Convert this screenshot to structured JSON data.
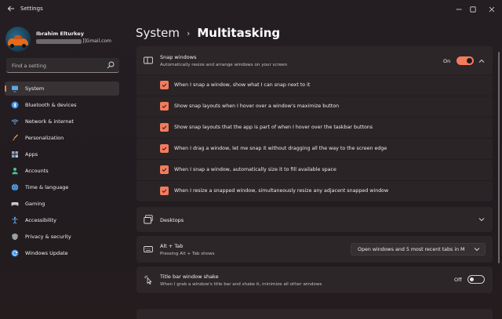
{
  "window": {
    "title": "Settings"
  },
  "user": {
    "name": "Ibrahim Elturkey",
    "email_suffix": "]]Gmail.com"
  },
  "search": {
    "placeholder": "Find a setting"
  },
  "sidebar": {
    "items": [
      {
        "label": "System",
        "icon": "monitor-icon",
        "color": "#5aa6e8",
        "active": true
      },
      {
        "label": "Bluetooth & devices",
        "icon": "bluetooth-icon",
        "color": "#3b8de0"
      },
      {
        "label": "Network & internet",
        "icon": "wifi-icon",
        "color": "#6ab0e8"
      },
      {
        "label": "Personalization",
        "icon": "brush-icon",
        "color": "#e09a5a"
      },
      {
        "label": "Apps",
        "icon": "apps-icon",
        "color": "#8fa6c8"
      },
      {
        "label": "Accounts",
        "icon": "person-icon",
        "color": "#4fc08f"
      },
      {
        "label": "Time & language",
        "icon": "globe-clock-icon",
        "color": "#5aa6e8"
      },
      {
        "label": "Gaming",
        "icon": "gamepad-icon",
        "color": "#c9c9c9"
      },
      {
        "label": "Accessibility",
        "icon": "accessibility-icon",
        "color": "#5aa6e8"
      },
      {
        "label": "Privacy & security",
        "icon": "shield-icon",
        "color": "#9aa0a6"
      },
      {
        "label": "Windows Update",
        "icon": "update-icon",
        "color": "#3b8de0"
      }
    ]
  },
  "breadcrumb": {
    "parent": "System",
    "separator": "›",
    "current": "Multitasking"
  },
  "snap": {
    "title": "Snap windows",
    "subtitle": "Automatically resize and arrange windows on your screen",
    "toggle_label": "On",
    "toggle_on": true,
    "options": [
      {
        "label": "When I snap a window, show what I can snap next to it",
        "checked": true
      },
      {
        "label": "Show snap layouts when I hover over a window's maximize button",
        "checked": true
      },
      {
        "label": "Show snap layouts that the app is part of when I hover over the taskbar buttons",
        "checked": true
      },
      {
        "label": "When I drag a window, let me snap it without dragging all the way to the screen edge",
        "checked": true
      },
      {
        "label": "When I snap a window, automatically size it to fill available space",
        "checked": true
      },
      {
        "label": "When I resize a snapped window, simultaneously resize any adjacent snapped window",
        "checked": true
      }
    ]
  },
  "desktops": {
    "title": "Desktops"
  },
  "alttab": {
    "title": "Alt + Tab",
    "subtitle": "Pressing Alt + Tab shows",
    "selected": "Open windows and 5 most recent tabs in M"
  },
  "shake": {
    "title": "Title bar window shake",
    "subtitle": "When I grab a window's title bar and shake it, minimize all other windows",
    "toggle_label": "Off",
    "toggle_on": false
  },
  "colors": {
    "accent": "#f37b5d",
    "card": "#2c2628",
    "background": "#231d20"
  }
}
